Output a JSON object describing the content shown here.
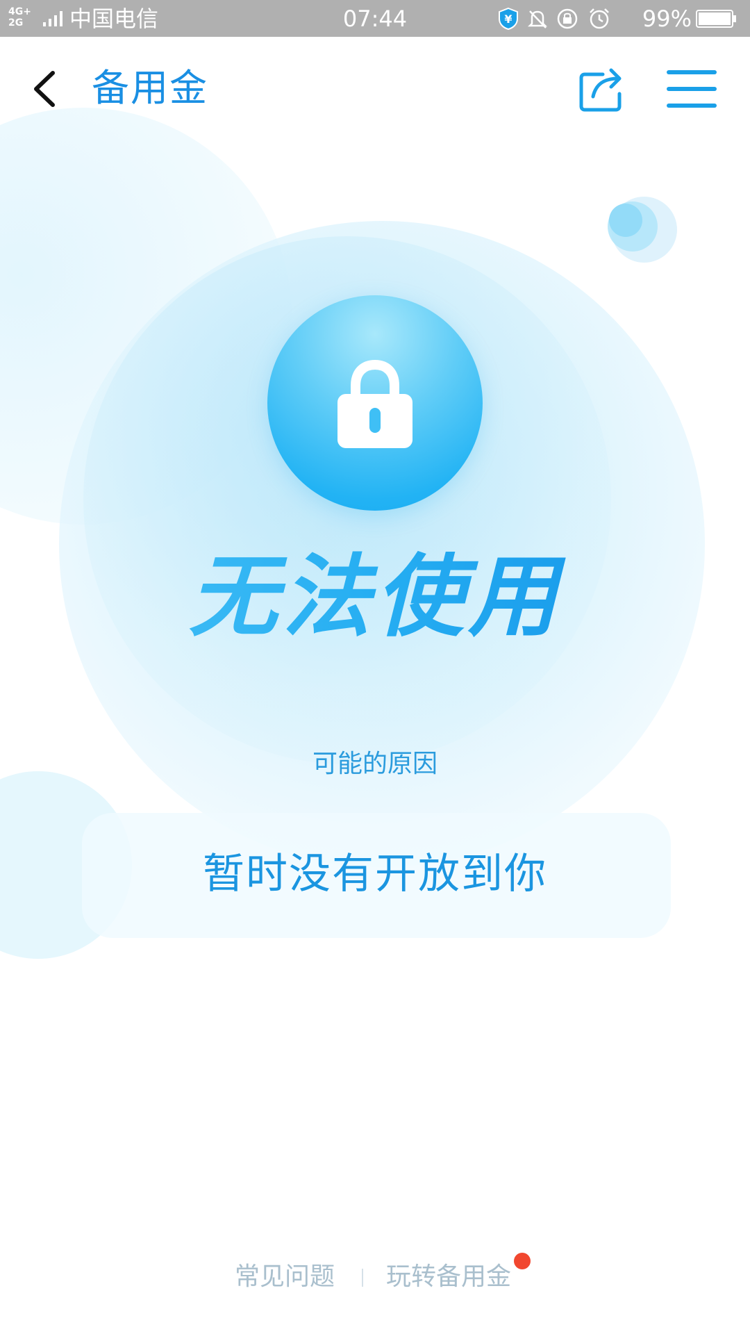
{
  "status_bar": {
    "network_top": "4G+",
    "network_bottom": "2G",
    "carrier": "中国电信",
    "time": "07:44",
    "battery_percent": "99%",
    "icons": [
      "wallet-shield-icon",
      "mute-bell-icon",
      "rotation-lock-icon",
      "alarm-icon"
    ]
  },
  "header": {
    "title": "备用金",
    "back_icon": "chevron-left-icon",
    "share_icon": "share-icon",
    "menu_icon": "hamburger-menu-icon"
  },
  "status_card": {
    "lock_icon": "lock-icon",
    "headline": "无法使用",
    "reason_label": "可能的原因",
    "reason_text": "暂时没有开放到你"
  },
  "footer": {
    "faq": "常见问题",
    "guide": "玩转备用金",
    "guide_badge": "red-dot"
  },
  "colors": {
    "accent": "#1a8fe3",
    "headline": "#22aaf0",
    "footer_text": "#a9bfcd",
    "badge": "#f1472f",
    "status_bar": "#b0b0b0"
  }
}
